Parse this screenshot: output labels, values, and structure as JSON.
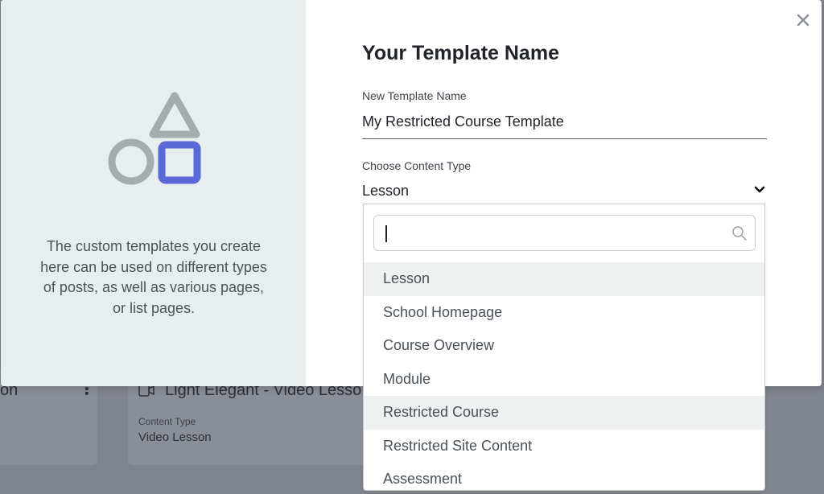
{
  "background": {
    "card_left_title": "on",
    "card_title": "Light Elegant - Video Lesson",
    "card_meta_label": "Content Type",
    "card_meta_value": "Video Lesson"
  },
  "modal": {
    "title": "Your Template Name",
    "description": "The custom templates you create here can be used on different types of posts, as well as various pages, or list pages.",
    "close_icon": "close-icon",
    "name_field": {
      "label": "New Template Name",
      "value": "My Restricted Course Template"
    },
    "type_field": {
      "label": "Choose Content Type",
      "selected": "Lesson"
    },
    "dropdown": {
      "search_value": "",
      "options": [
        {
          "label": "Lesson",
          "highlighted": true
        },
        {
          "label": "School Homepage",
          "highlighted": false
        },
        {
          "label": "Course Overview",
          "highlighted": false
        },
        {
          "label": "Module",
          "highlighted": false
        },
        {
          "label": "Restricted Course",
          "highlighted": true
        },
        {
          "label": "Restricted Site Content",
          "highlighted": false
        },
        {
          "label": "Assessment",
          "highlighted": false
        }
      ]
    }
  },
  "colors": {
    "accent": "#5b68d8",
    "shape_gray": "#a4adad",
    "left_panel": "#e8eded",
    "highlight_row": "#eff1f1"
  }
}
